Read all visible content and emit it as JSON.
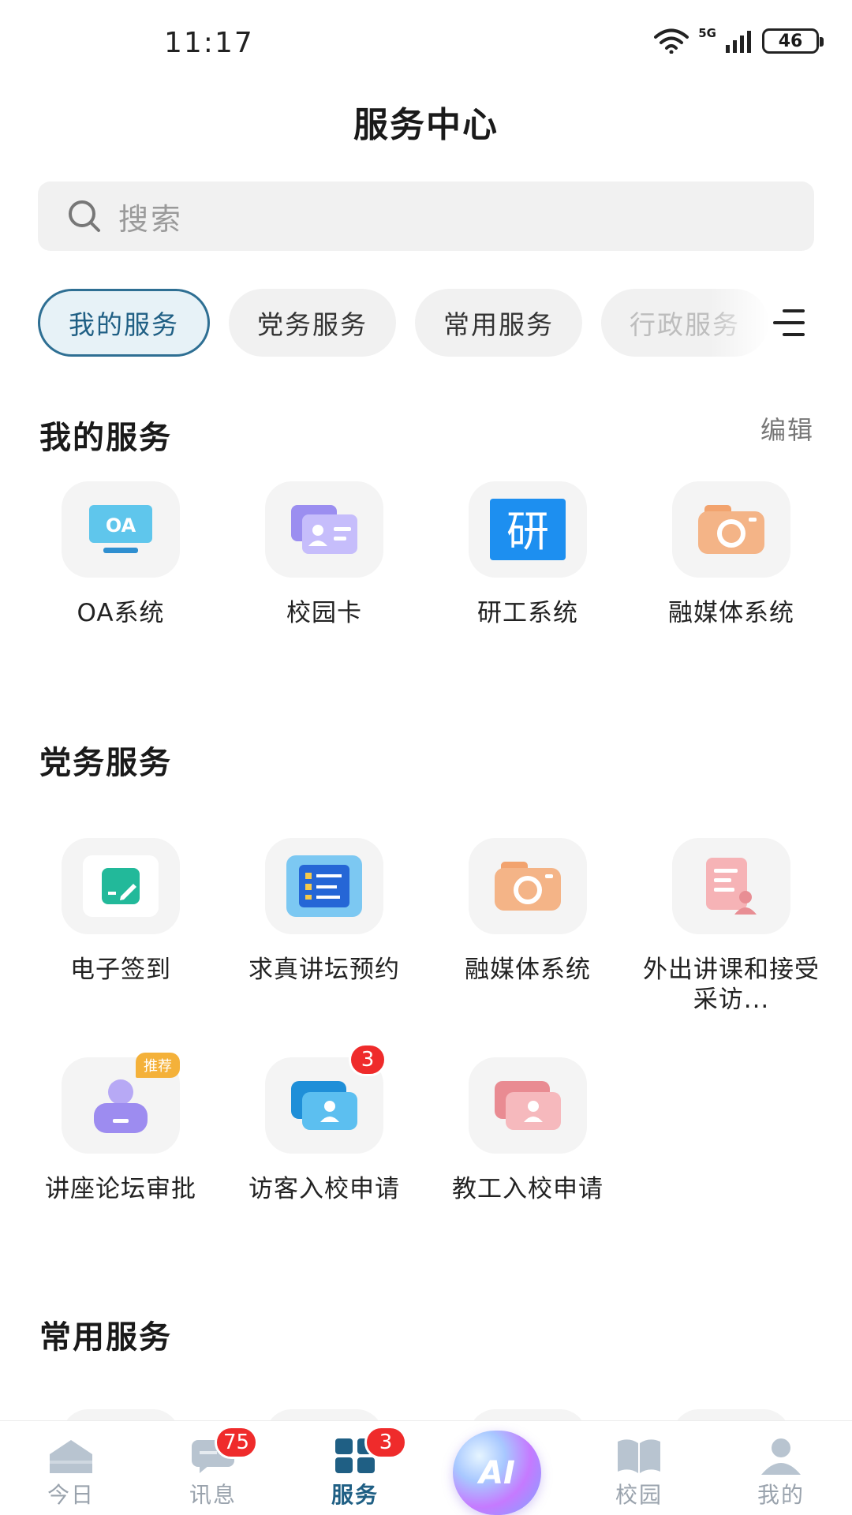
{
  "status_bar": {
    "time": "11:17",
    "network": "5G",
    "battery": "46"
  },
  "header": {
    "title": "服务中心"
  },
  "search": {
    "placeholder": "搜索"
  },
  "tabs": [
    {
      "label": "我的服务",
      "active": true
    },
    {
      "label": "党务服务",
      "active": false
    },
    {
      "label": "常用服务",
      "active": false
    },
    {
      "label": "行政服务",
      "active": false
    }
  ],
  "my_services": {
    "title": "我的服务",
    "edit_label": "编辑",
    "items": [
      {
        "label": "OA系统",
        "icon": "oa-monitor-icon"
      },
      {
        "label": "校园卡",
        "icon": "campus-card-icon"
      },
      {
        "label": "研工系统",
        "icon": "yan-character-icon"
      },
      {
        "label": "融媒体系统",
        "icon": "camera-icon"
      }
    ]
  },
  "party_services": {
    "title": "党务服务",
    "items": [
      {
        "label": "电子签到",
        "icon": "edit-note-icon"
      },
      {
        "label": "求真讲坛预约",
        "icon": "list-board-icon"
      },
      {
        "label": "融媒体系统",
        "icon": "camera-icon"
      },
      {
        "label": "外出讲课和接受采访...",
        "icon": "document-person-icon"
      },
      {
        "label": "讲座论坛审批",
        "icon": "user-card-icon",
        "tag": "推荐"
      },
      {
        "label": "访客入校申请",
        "icon": "visitor-cards-icon",
        "badge": "3"
      },
      {
        "label": "教工入校申请",
        "icon": "staff-cards-icon"
      }
    ]
  },
  "common_services": {
    "title": "常用服务"
  },
  "bottom_nav": [
    {
      "label": "今日",
      "icon": "home-icon"
    },
    {
      "label": "讯息",
      "icon": "message-icon",
      "badge": "75"
    },
    {
      "label": "服务",
      "icon": "grid-icon",
      "badge": "3",
      "active": true
    },
    {
      "label": "AI",
      "icon": "ai-orb-icon"
    },
    {
      "label": "校园",
      "icon": "book-icon"
    },
    {
      "label": "我的",
      "icon": "person-icon"
    }
  ],
  "colors": {
    "accent": "#1f5f84",
    "badge": "#ef2b2b",
    "tag": "#f4b13a"
  }
}
